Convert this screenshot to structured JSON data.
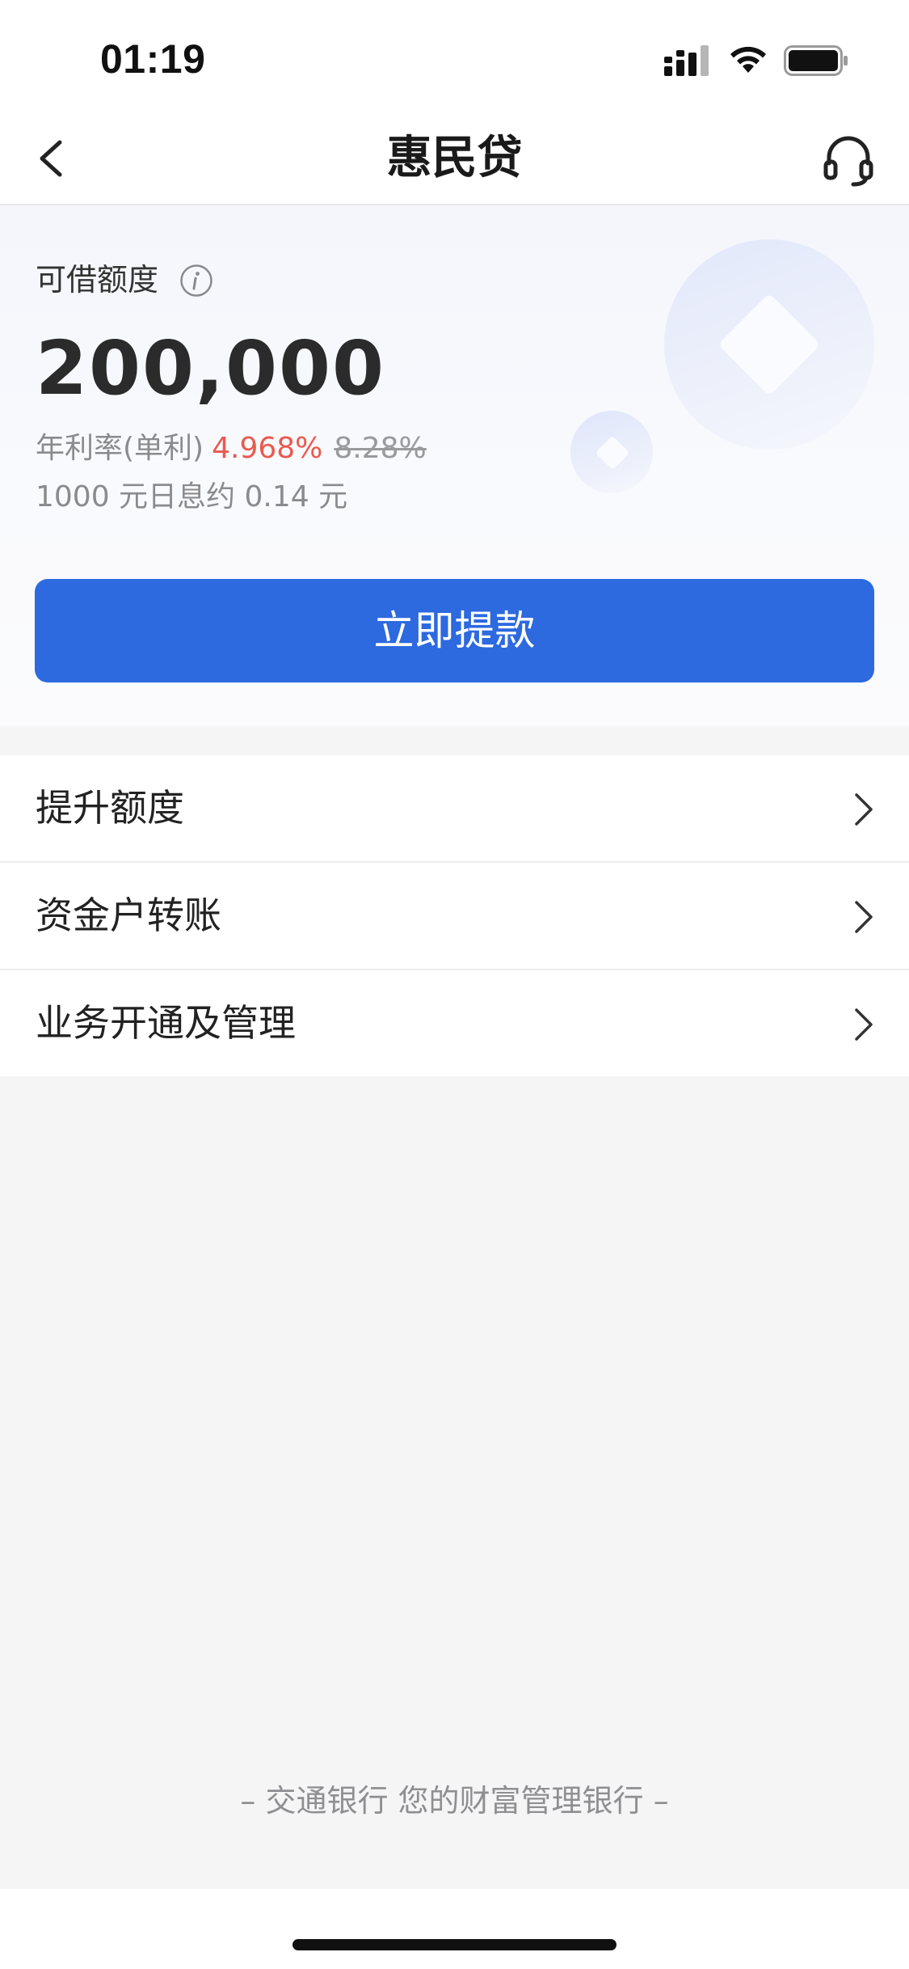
{
  "status_bar": {
    "time": "01:19"
  },
  "header": {
    "title": "惠民贷"
  },
  "loan": {
    "limit_label": "可借额度",
    "amount": "200,000",
    "rate_label": "年利率(单利)",
    "rate_current": "4.968%",
    "rate_original": "8.28%",
    "daily_interest": "1000 元日息约 0.14 元",
    "withdraw_button": "立即提款"
  },
  "menu": {
    "items": [
      {
        "label": "提升额度"
      },
      {
        "label": "资金户转账"
      },
      {
        "label": "业务开通及管理"
      }
    ]
  },
  "footer": {
    "slogan": "– 交通银行 您的财富管理银行 –"
  },
  "colors": {
    "primary": "#2d69df",
    "rate_highlight": "#ea5a4f",
    "background": "#f5f5f6"
  },
  "icons": [
    "signal-icon",
    "wifi-icon",
    "battery-icon",
    "back-arrow-icon",
    "headset-icon",
    "info-icon",
    "chevron-right-icon"
  ]
}
